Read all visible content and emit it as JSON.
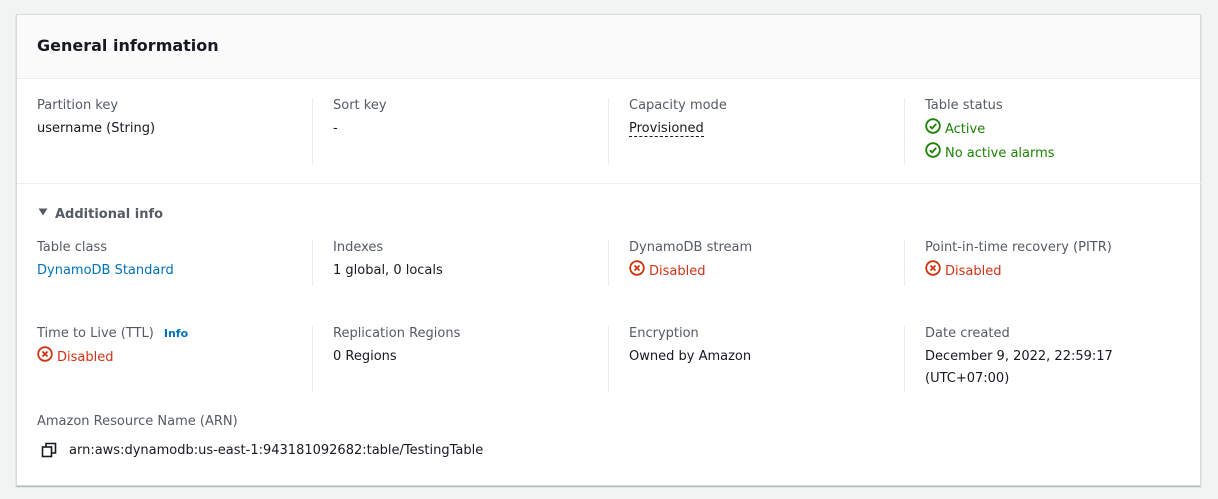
{
  "header": {
    "title": "General information"
  },
  "overview": {
    "partition_key": {
      "label": "Partition key",
      "value": "username (String)"
    },
    "sort_key": {
      "label": "Sort key",
      "value": "-"
    },
    "capacity_mode": {
      "label": "Capacity mode",
      "value": "Provisioned"
    },
    "table_status": {
      "label": "Table status",
      "status": "Active",
      "alarms": "No active alarms"
    }
  },
  "additional": {
    "toggle_label": "Additional info",
    "table_class": {
      "label": "Table class",
      "value": "DynamoDB Standard"
    },
    "indexes": {
      "label": "Indexes",
      "value": "1 global, 0 locals"
    },
    "stream": {
      "label": "DynamoDB stream",
      "value": "Disabled"
    },
    "pitr": {
      "label": "Point-in-time recovery (PITR)",
      "value": "Disabled"
    },
    "ttl": {
      "label": "Time to Live (TTL)",
      "info": "Info",
      "value": "Disabled"
    },
    "replication": {
      "label": "Replication Regions",
      "value": "0 Regions"
    },
    "encryption": {
      "label": "Encryption",
      "value": "Owned by Amazon"
    },
    "date_created": {
      "label": "Date created",
      "date": "December 9, 2022, 22:59:17",
      "tz": "(UTC+07:00)"
    },
    "arn": {
      "label": "Amazon Resource Name (ARN)",
      "value": "arn:aws:dynamodb:us-east-1:943181092682:table/TestingTable"
    }
  },
  "colors": {
    "success": "#1d8102",
    "error": "#d13212",
    "link": "#0073bb"
  },
  "icons": {
    "success": "status-check-icon",
    "error": "status-x-icon",
    "expand": "caret-down-icon",
    "copy": "copy-icon"
  }
}
